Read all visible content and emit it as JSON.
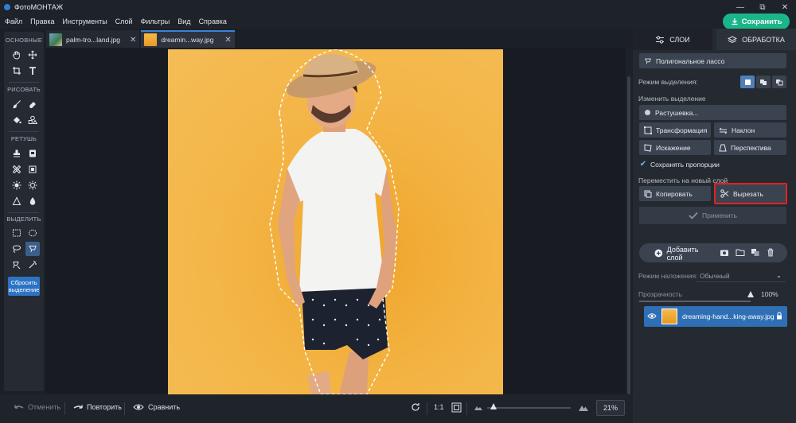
{
  "app": {
    "title": "ФотоМОНТАЖ",
    "save_label": "Сохранить"
  },
  "window_controls": [
    "—",
    "⧉",
    "✕"
  ],
  "menu": [
    "Файл",
    "Правка",
    "Инструменты",
    "Слой",
    "Фильтры",
    "Вид",
    "Справка"
  ],
  "toolbar": {
    "sections": [
      "ОСНОВНЫЕ",
      "РИСОВАТЬ",
      "РЕТУШЬ",
      "ВЫДЕЛИТЬ"
    ],
    "reset_label": "Сбросить выделение"
  },
  "tabs": [
    {
      "label": "palm-tro...land.jpg",
      "active": false
    },
    {
      "label": "dreamin...way.jpg",
      "active": true
    }
  ],
  "bottom": {
    "undo": "Отменить",
    "redo": "Повторить",
    "compare": "Сравнить",
    "ratio": "1:1",
    "zoom": "21%",
    "zoom_level_percent": 21
  },
  "panel": {
    "tabs": [
      "СЛОИ",
      "ОБРАБОТКА"
    ],
    "tool_name": "Полигональное лассо",
    "selection_mode_label": "Режим выделения:",
    "change_selection_label": "Изменить выделение",
    "feather": "Растушевка...",
    "transform": "Трансформация",
    "skew": "Наклон",
    "distort": "Искажение",
    "perspective": "Перспектива",
    "keep_proportions": "Сохранять пропорции",
    "move_new_layer": "Переместить на новый слой",
    "copy": "Копировать",
    "cut": "Вырезать",
    "apply": "Применить",
    "add_layer": "Добавить слой",
    "blend_label": "Режим наложения:",
    "blend_value": "Обычный",
    "opacity_label": "Прозрачность",
    "opacity_value": "100%",
    "layer_name": "dreaming-hand...king-away.jpg"
  },
  "colors": {
    "accent": "#2f6fb5",
    "save": "#1bb58a",
    "highlight": "#e02323",
    "photo_bg": "#f3b444"
  }
}
